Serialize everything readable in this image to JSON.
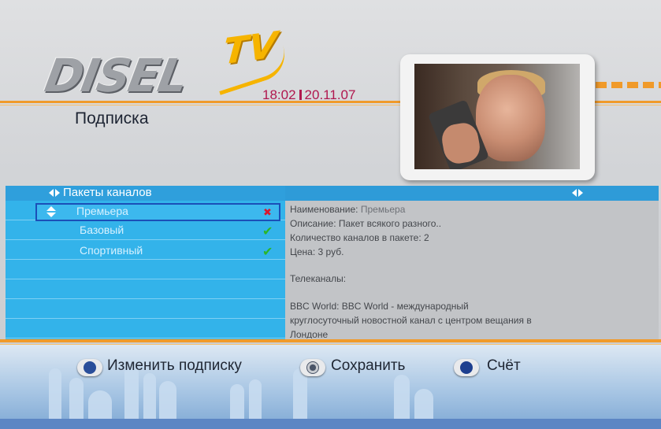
{
  "header": {
    "logo_text": "DISEL",
    "logo_tv": "TV",
    "time": "18:02",
    "date": "20.11.07",
    "page_title": "Подписка"
  },
  "panel": {
    "header_label": "Пакеты каналов",
    "items": [
      {
        "label": "Премьера",
        "status": "✖",
        "selected": true
      },
      {
        "label": "Базовый",
        "status": "✔"
      },
      {
        "label": "Спортивный",
        "status": "✔"
      }
    ]
  },
  "details": {
    "name_label": "Наименование:",
    "name_value": "Премьера",
    "desc_label": "Описание:",
    "desc_value": "Пакет всякого разного..",
    "count_label": "Количество каналов в пакете:",
    "count_value": "2",
    "price_label": "Цена:",
    "price_value": "3 руб.",
    "channels_title": "Телеканалы:",
    "channel_line1": "BBC World: BBC World - международный",
    "channel_line2": "круглосуточный новостной канал с центром вещания в",
    "channel_line3": "Лондоне"
  },
  "footer": {
    "ok_label": "Изменить подписку",
    "save_label": "Сохранить",
    "account_label": "Счёт"
  },
  "colors": {
    "accent_orange": "#f09a2a",
    "list_blue": "#33b3ea",
    "time_magenta": "#b0174e"
  }
}
